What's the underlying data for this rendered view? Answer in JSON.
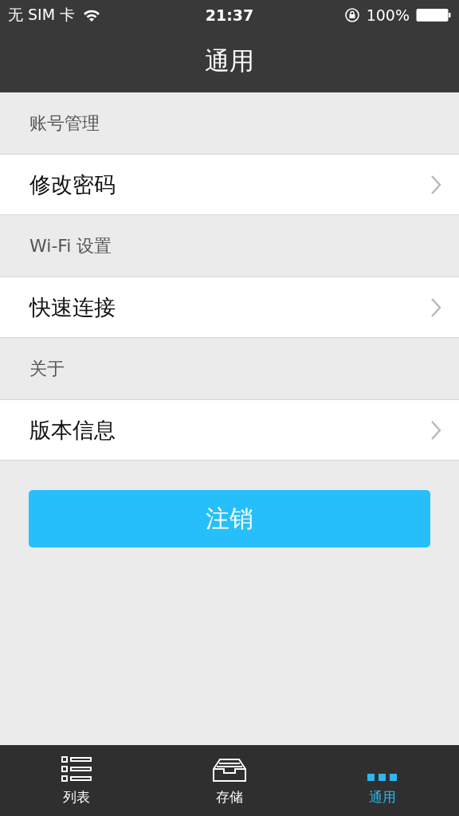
{
  "status_bar": {
    "carrier": "无 SIM 卡",
    "time": "21:37",
    "battery": "100%"
  },
  "nav": {
    "title": "通用"
  },
  "sections": [
    {
      "header": "账号管理",
      "rows": [
        {
          "label": "修改密码"
        }
      ]
    },
    {
      "header": "Wi-Fi 设置",
      "rows": [
        {
          "label": "快速连接"
        }
      ]
    },
    {
      "header": "关于",
      "rows": [
        {
          "label": "版本信息"
        }
      ]
    }
  ],
  "logout_button": "注销",
  "tabs": [
    {
      "label": "列表",
      "kind": "list",
      "selected": false
    },
    {
      "label": "存储",
      "kind": "tray",
      "selected": false
    },
    {
      "label": "通用",
      "kind": "more",
      "selected": true
    }
  ]
}
